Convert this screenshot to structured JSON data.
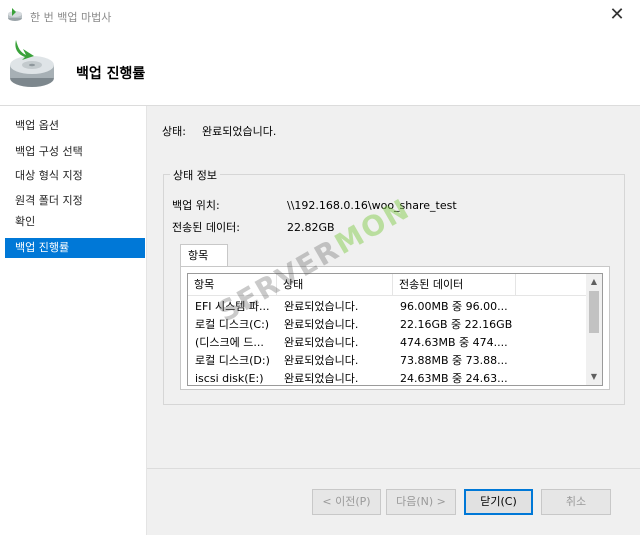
{
  "window": {
    "title": "한 번 백업 마법사",
    "close_glyph": "✕"
  },
  "header": {
    "heading": "백업 진행률"
  },
  "sidebar": {
    "items": [
      {
        "label": "백업 옵션"
      },
      {
        "label": "백업 구성 선택"
      },
      {
        "label": "대상 형식 지정"
      },
      {
        "label": "원격 폴더 지정"
      },
      {
        "label": "확인"
      },
      {
        "label": "백업 진행률",
        "active": true
      }
    ]
  },
  "status": {
    "label": "상태:",
    "value": "완료되었습니다."
  },
  "status_info": {
    "legend": "상태 정보",
    "location_label": "백업 위치:",
    "location_value": "\\\\192.168.0.16\\woo_share_test",
    "transferred_label": "전송된 데이터:",
    "transferred_value": "22.82GB"
  },
  "items_tab": {
    "label": "항목"
  },
  "items_table": {
    "columns": [
      "항목",
      "상태",
      "전송된 데이터"
    ],
    "rows": [
      [
        "EFI 시스템 파...",
        "완료되었습니다.",
        "96.00MB 중 96.00..."
      ],
      [
        "로컬 디스크(C:)",
        "완료되었습니다.",
        "22.16GB 중 22.16GB"
      ],
      [
        "(디스크에 드...",
        "완료되었습니다.",
        "474.63MB 중 474...."
      ],
      [
        "로컬 디스크(D:)",
        "완료되었습니다.",
        "73.88MB 중 73.88..."
      ],
      [
        "iscsi disk(E:)",
        "완료되었습니다.",
        "24.63MB 중 24.63..."
      ]
    ]
  },
  "buttons": {
    "prev": "< 이전(P)",
    "next": "다음(N) >",
    "close": "닫기(C)",
    "cancel": "취소"
  },
  "watermark": {
    "part1": "SERVER",
    "part2": "MON"
  },
  "colors": {
    "accent": "#0078d7",
    "content_bg": "#f0f0f0"
  }
}
